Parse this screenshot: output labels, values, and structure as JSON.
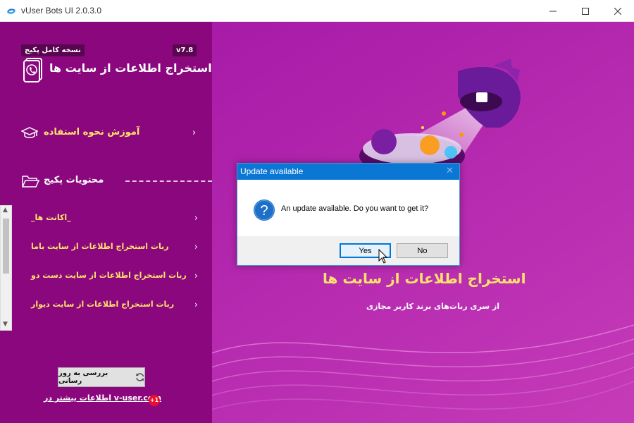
{
  "window": {
    "title": "vUser Bots UI 2.0.3.0"
  },
  "sidebar": {
    "package_badge": "نسخه کامل پکیج",
    "version": "v7.8",
    "app_name": "استخراج اطلاعات از سایت ها",
    "tutorial_label": "آموزش نحوه استفاده",
    "contents_label": "محتویات پکیج",
    "items": [
      {
        "label": "_اکانت ها_"
      },
      {
        "label": "ربات استخراج اطلاعات از سایت باما"
      },
      {
        "label": "ربات استخراج اطلاعات از سایت دست دو"
      },
      {
        "label": "ربات استخراج اطلاعات از سایت دیوار"
      }
    ],
    "update_button": "بررسی به روز رسانی",
    "more_info": "اطلاعات بیشتر در v-user.com",
    "badge_count": "+1"
  },
  "hero": {
    "title": "استخراج اطلاعات از سایت ها",
    "subtitle": "از سری ربات‌های برند کاربر مجازی"
  },
  "dialog": {
    "title": "Update available",
    "message": "An update available. Do you want to get it?",
    "yes_label": "Yes",
    "no_label": "No"
  },
  "colors": {
    "sidebar_bg": "#8b077e",
    "main_bg": "#b123a9",
    "accent_yellow": "#ffe36a",
    "dialog_title_bg": "#0b77d5"
  }
}
